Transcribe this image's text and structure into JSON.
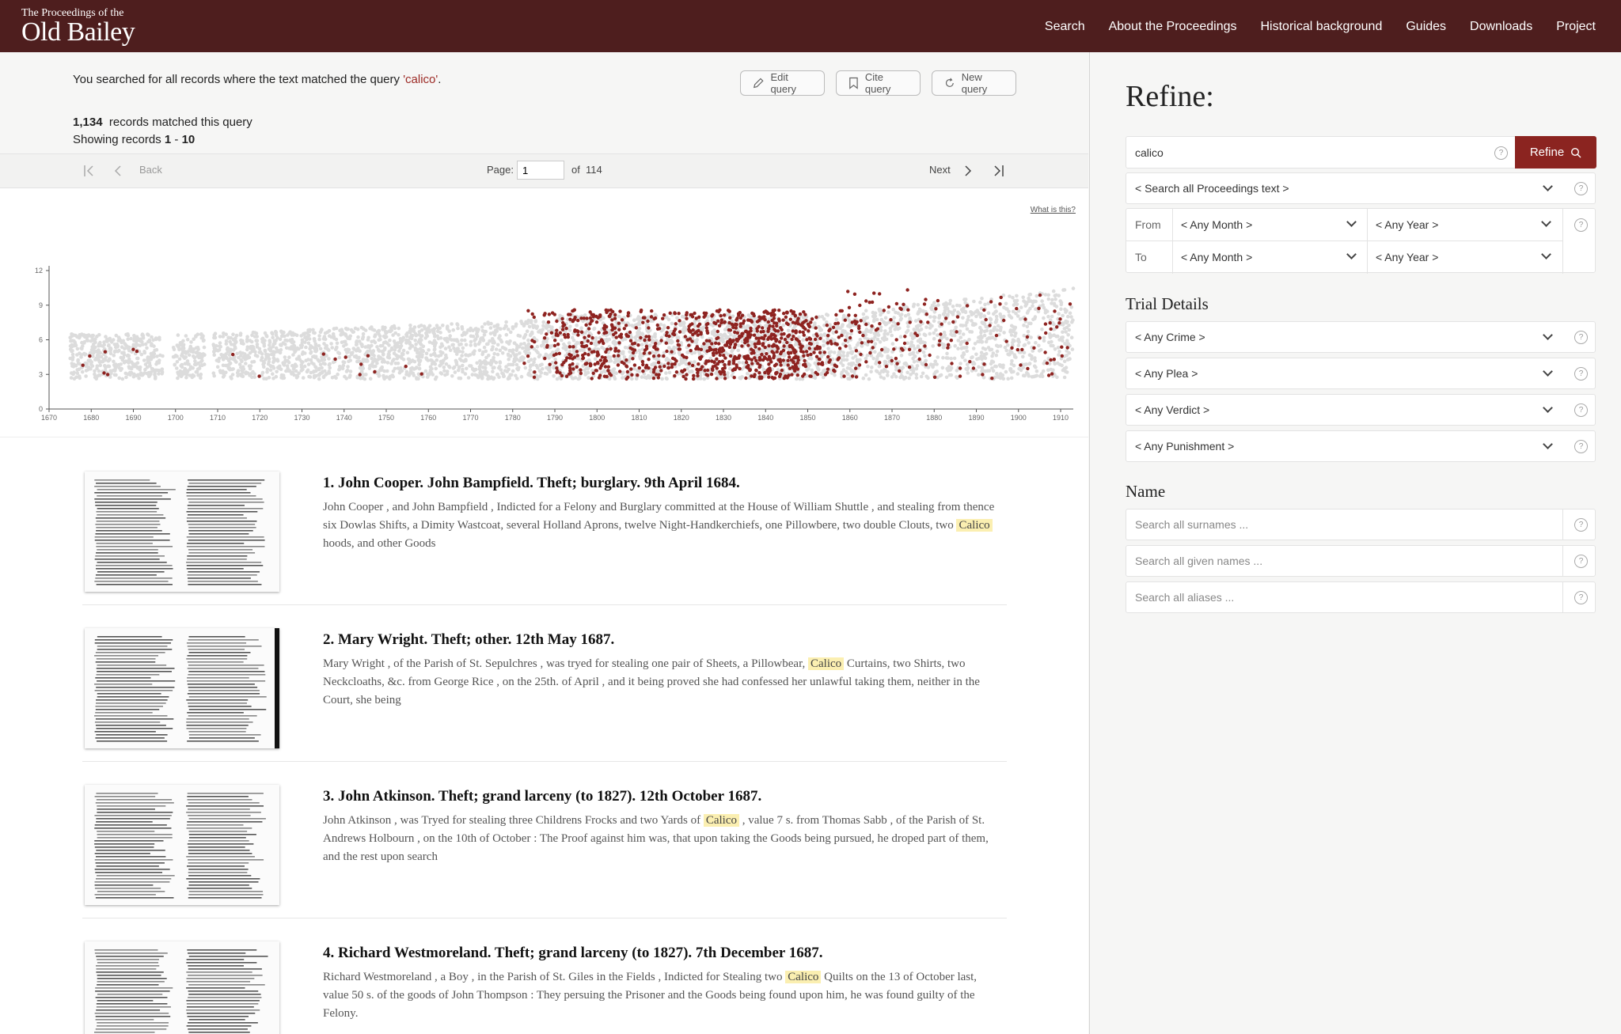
{
  "header": {
    "logo_small": "The Proceedings of the",
    "logo_big": "Old Bailey",
    "nav": [
      "Search",
      "About the Proceedings",
      "Historical background",
      "Guides",
      "Downloads",
      "Project"
    ]
  },
  "search": {
    "query_prefix": "You searched for all records where the text matched the query ",
    "query_value": "'calico'",
    "query_suffix": ".",
    "count": "1,134",
    "count_label": "records matched this query",
    "showing_prefix": "Showing records ",
    "showing_from": "1",
    "showing_sep": " - ",
    "showing_to": "10",
    "edit_query": "Edit query",
    "cite_query": "Cite query",
    "new_query": "New query"
  },
  "pager": {
    "back": "Back",
    "page_label": "Page:",
    "page_value": "1",
    "of_label": "of",
    "total_pages": "114",
    "next": "Next"
  },
  "chart_data": {
    "type": "scatter",
    "x_ticks": [
      "1670",
      "1680",
      "1690",
      "1700",
      "1710",
      "1720",
      "1730",
      "1740",
      "1750",
      "1760",
      "1770",
      "1780",
      "1790",
      "1800",
      "1810",
      "1820",
      "1830",
      "1840",
      "1850",
      "1860",
      "1870",
      "1880",
      "1890",
      "1900",
      "1910"
    ],
    "y_ticks": [
      "0",
      "3",
      "6",
      "9",
      "12"
    ],
    "xlim": [
      1670,
      1913
    ],
    "ylim": [
      0,
      12
    ],
    "what_is_this": "What is this?",
    "background_color": "#dcdcdc",
    "match_color": "#8e2320",
    "match_density": [
      {
        "x": 1680,
        "count": 2
      },
      {
        "x": 1685,
        "count": 3
      },
      {
        "x": 1690,
        "count": 2
      },
      {
        "x": 1715,
        "count": 1
      },
      {
        "x": 1720,
        "count": 1
      },
      {
        "x": 1735,
        "count": 1
      },
      {
        "x": 1740,
        "count": 2
      },
      {
        "x": 1745,
        "count": 4
      },
      {
        "x": 1755,
        "count": 1
      },
      {
        "x": 1760,
        "count": 1
      },
      {
        "x": 1785,
        "count": 10
      },
      {
        "x": 1790,
        "count": 40
      },
      {
        "x": 1795,
        "count": 55
      },
      {
        "x": 1800,
        "count": 70
      },
      {
        "x": 1805,
        "count": 55
      },
      {
        "x": 1810,
        "count": 40
      },
      {
        "x": 1815,
        "count": 40
      },
      {
        "x": 1820,
        "count": 50
      },
      {
        "x": 1825,
        "count": 65
      },
      {
        "x": 1830,
        "count": 80
      },
      {
        "x": 1835,
        "count": 90
      },
      {
        "x": 1840,
        "count": 110
      },
      {
        "x": 1845,
        "count": 95
      },
      {
        "x": 1850,
        "count": 65
      },
      {
        "x": 1855,
        "count": 40
      },
      {
        "x": 1860,
        "count": 28
      },
      {
        "x": 1865,
        "count": 20
      },
      {
        "x": 1870,
        "count": 16
      },
      {
        "x": 1875,
        "count": 14
      },
      {
        "x": 1880,
        "count": 14
      },
      {
        "x": 1885,
        "count": 10
      },
      {
        "x": 1890,
        "count": 8
      },
      {
        "x": 1895,
        "count": 8
      },
      {
        "x": 1900,
        "count": 8
      },
      {
        "x": 1905,
        "count": 10
      },
      {
        "x": 1910,
        "count": 12
      }
    ]
  },
  "results": [
    {
      "title": "1. John Cooper. John Bampfield. Theft; burglary. 9th April 1684.",
      "pre": "John Cooper , and John Bampfield , Indicted for a Felony and Burglary committed at the House of William Shuttle , and stealing from thence six Dowlas Shifts, a Dimity Wastcoat, several Holland Aprons, twelve Night-Handkerchiefs, one Pillowbere, two double Clouts, two ",
      "hl": "Calico",
      "post": " hoods, and other Goods"
    },
    {
      "title": "2. Mary Wright. Theft; other. 12th May 1687.",
      "pre": "Mary Wright , of the Parish of St. Sepulchres , was tryed for stealing one pair of Sheets, a Pillowbear, ",
      "hl": "Calico",
      "post": " Curtains, two Shirts, two Neckcloaths, &c. from George Rice , on the 25th. of April , and it being proved she had confessed her unlawful taking them, neither in the Court, she being"
    },
    {
      "title": "3. John Atkinson. Theft; grand larceny (to 1827). 12th October 1687.",
      "pre": "John Atkinson , was Tryed for stealing three Childrens Frocks and two Yards of ",
      "hl": "Calico",
      "post": " , value 7 s. from Thomas Sabb , of the Parish of St. Andrews Holbourn , on the 10th of October : The Proof against him was, that upon taking the Goods being pursued, he droped part of them, and the rest upon search"
    },
    {
      "title": "4. Richard Westmoreland. Theft; grand larceny (to 1827). 7th December 1687.",
      "pre": "Richard Westmoreland , a Boy , in the Parish of St. Giles in the Fields , Indicted for Stealing two ",
      "hl": "Calico",
      "post": " Quilts on the 13 of October last, value 50 s. of the goods of John Thompson : They persuing the Prisoner and the Goods being found upon him, he was found guilty of the Felony."
    }
  ],
  "sidebar": {
    "title": "Refine:",
    "search_value": "calico",
    "refine_button": "Refine",
    "scope": "< Search all Proceedings text >",
    "from_label": "From",
    "to_label": "To",
    "any_month": "< Any Month >",
    "any_year": "< Any Year >",
    "trial_details": "Trial Details",
    "any_crime": "< Any Crime >",
    "any_plea": "< Any Plea >",
    "any_verdict": "< Any Verdict >",
    "any_punishment": "< Any Punishment >",
    "name_heading": "Name",
    "surnames_placeholder": "Search all surnames ...",
    "given_placeholder": "Search all given names ...",
    "aliases_placeholder": "Search all aliases ..."
  },
  "colors": {
    "header_bg": "#4e1e1e",
    "accent": "#8b2420",
    "highlight": "#fbefb1"
  }
}
